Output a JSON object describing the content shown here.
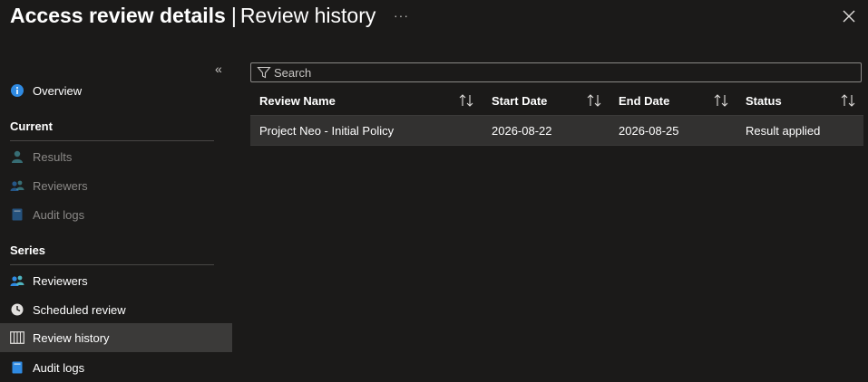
{
  "header": {
    "title_main": "Access review details",
    "separator": "|",
    "title_sub": "Review history",
    "more_label": "···"
  },
  "sidebar": {
    "collapse_label": "«",
    "overview": "Overview",
    "current_section": "Current",
    "current_items": [
      "Results",
      "Reviewers",
      "Audit logs"
    ],
    "series_section": "Series",
    "series_items": [
      "Reviewers",
      "Scheduled review",
      "Review history",
      "Audit logs"
    ]
  },
  "search": {
    "placeholder": "Search"
  },
  "table": {
    "columns": [
      "Review Name",
      "Start Date",
      "End Date",
      "Status"
    ],
    "rows": [
      {
        "name": "Project Neo - Initial Policy",
        "start": "2026-08-22",
        "end": "2026-08-25",
        "status": "Result applied"
      }
    ]
  },
  "colors": {
    "background": "#1b1a19",
    "selected_nav": "#3b3a39",
    "row_background": "#323130",
    "accent_blue": "#2f8ae2",
    "teal": "#4fb3bf"
  }
}
